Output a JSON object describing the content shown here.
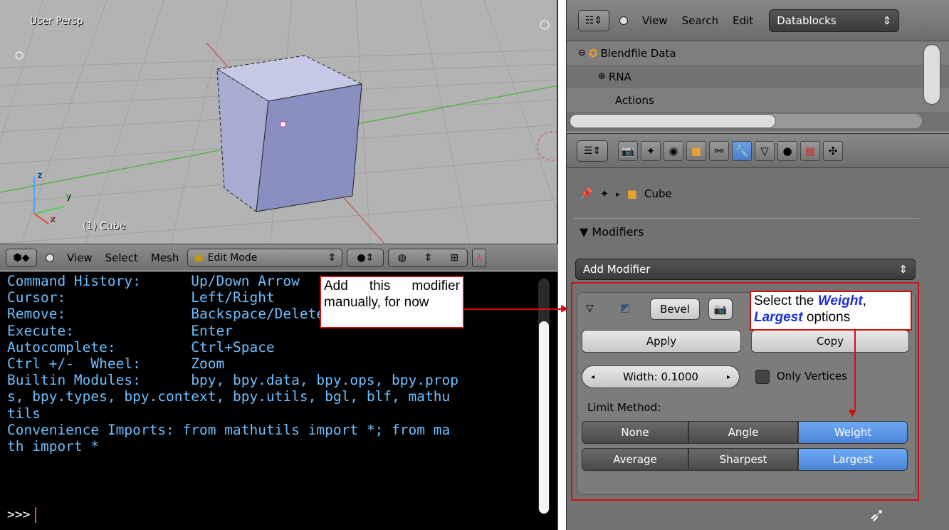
{
  "viewport": {
    "title": "User Persp",
    "object_label": "(1) Cube",
    "axis_x": "x",
    "axis_y": "y",
    "axis_z": "z"
  },
  "viewport_header": {
    "menus": [
      "View",
      "Select",
      "Mesh"
    ],
    "mode": "Edit Mode"
  },
  "console": {
    "lines": [
      "Command History:      Up/Down Arrow",
      "Cursor:               Left/Right",
      "Remove:               Backspace/Delete",
      "Execute:              Enter",
      "Autocomplete:         Ctrl+Space",
      "Ctrl +/-  Wheel:      Zoom",
      "Builtin Modules:      bpy, bpy.data, bpy.ops, bpy.prop",
      "s, bpy.types, bpy.context, bpy.utils, bgl, blf, mathu",
      "tils",
      "Convenience Imports: from mathutils import *; from ma",
      "th import *"
    ],
    "prompt": ">>>"
  },
  "outliner": {
    "menus": [
      "View",
      "Search",
      "Edit"
    ],
    "display_mode": "Datablocks",
    "rows": [
      "Blendfile Data",
      "RNA",
      "Actions"
    ]
  },
  "properties": {
    "breadcrumb_object": "Cube",
    "panel_title": "Modifiers",
    "add_modifier": "Add Modifier",
    "modifier_name": "Bevel",
    "apply": "Apply",
    "copy": "Copy",
    "width": "Width: 0.1000",
    "only_vertices": "Only Vertices",
    "limit_method_label": "Limit Method:",
    "limit_row1": [
      "None",
      "Angle",
      "Weight"
    ],
    "limit_row2": [
      "Average",
      "Sharpest",
      "Largest"
    ]
  },
  "annotations": {
    "callout1": "Add this modifier manually, for now",
    "callout2_pre": "Select the",
    "callout2_weight": "Weight",
    "callout2_largest": "Largest",
    "callout2_post": "options"
  },
  "colors": {
    "accent_blue": "#5b95e6",
    "annotation_red": "#d01010",
    "console_text": "#6cbfff"
  }
}
